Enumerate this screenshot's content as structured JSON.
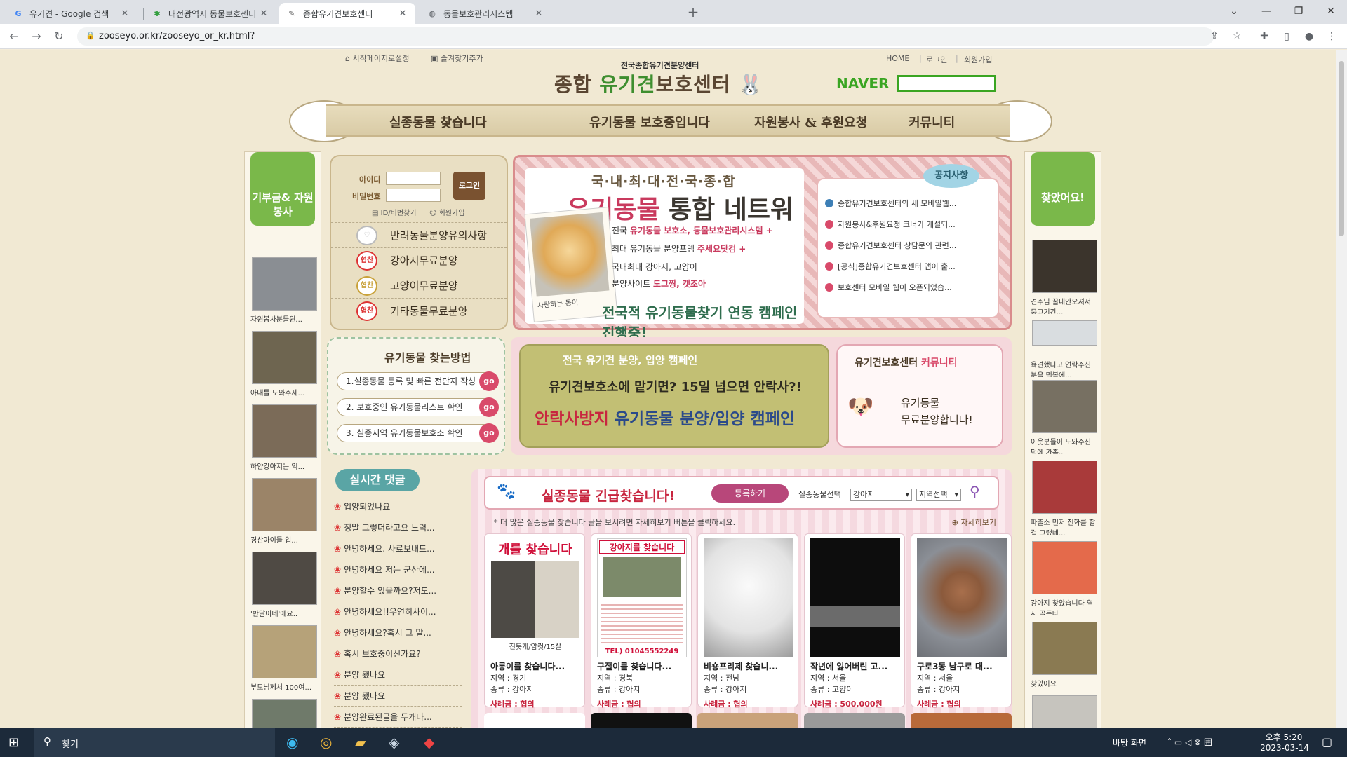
{
  "browser": {
    "tabs": [
      {
        "title": "유기견 - Google 검색",
        "icon": "google-icon"
      },
      {
        "title": "대전광역시 동물보호센터",
        "icon": "leaf-icon"
      },
      {
        "title": "종합유기견보호센터",
        "icon": "site-icon"
      },
      {
        "title": "동물보호관리시스템",
        "icon": "globe-icon"
      }
    ],
    "url": "zooseyo.or.kr/zooseyo_or_kr.html?"
  },
  "header": {
    "start_page": "시작페이지로설정",
    "bookmark": "즐겨찾기추가",
    "home": "HOME",
    "login": "로그인",
    "join": "회원가입",
    "logo_sub": "전국종합유기견분양센터",
    "logo_main_1": "종합",
    "logo_main_2": "유기견",
    "logo_main_3": "보호센터",
    "naver": "NAVER"
  },
  "menu": [
    "실종동물 찾습니다",
    "유기동물 보호중입니다",
    "자원봉사 & 후원요청",
    "커뮤니티"
  ],
  "left_side": {
    "title": "기부금& 자원봉사",
    "items": [
      "자원봉사분들원...",
      "아내를 도와주세...",
      "하얀강아지는 익...",
      "경산아이들 입...",
      "'반달이네'에요..",
      "부모님께서 100여..."
    ]
  },
  "right_side": {
    "title": "찾았어요!",
    "items": [
      "견주님 꿀내안오셔서 뭉고기간...",
      "",
      "육견했다고 연락주신 분을 먹볼에...",
      "이웃분들이 도와주신 덕에 가족..",
      "파출소 먼저 전화를 할걸 그랬네...",
      "강아지 찾았습니다 역시 골든타...",
      "찾았어요"
    ]
  },
  "login": {
    "id_label": "아이디",
    "pw_label": "비밀번호",
    "button": "로그인",
    "find": "ID/비번찾기",
    "join": "회원가입",
    "menu": [
      {
        "icon": "heart-icon",
        "label": "반려동물분양유의사항",
        "badge": ""
      },
      {
        "icon": "badge-icon",
        "label": "강아지무료분양",
        "badge": "협찬"
      },
      {
        "icon": "badge-icon",
        "label": "고양이무료분양",
        "badge": "협찬"
      },
      {
        "icon": "badge-icon",
        "label": "기타동물무료분양",
        "badge": "협찬"
      }
    ]
  },
  "banner": {
    "line1": "국·내·최·대·전·국·종·합",
    "line2a": "유기동물",
    "line2b": "통합 네트워크!",
    "dog_caption": "사랑하는 몽이",
    "lines": [
      {
        "pre": "전국 ",
        "hl": "유기동물 보호소, 동물보호관리시스템 +",
        "post": ""
      },
      {
        "pre": "최대 유기동물 분양프렘 ",
        "hl": "주세요닷컴 +",
        "post": ""
      },
      {
        "pre": "국내최대 강아지, 고양이",
        "hl": "",
        "post": ""
      },
      {
        "pre": "분양사이트 ",
        "hl": "도그짱, 캣조아",
        "post": ""
      }
    ],
    "line_last": "전국적 유기동물찾기 연동 캠페인 진행중!"
  },
  "notice": {
    "title": "공지사항",
    "items": [
      "종합유기견보호센터의 새 모바일웹...",
      "자원봉사&후원요청 코너가 개설되...",
      "종합유기견보호센터 상담문의 관련...",
      "[공식]종합유기견보호센터 앱이 출...",
      "보호센터 모바일 웹이 오픈되었습..."
    ]
  },
  "howto": {
    "title": "유기동물 찾는방법",
    "steps": [
      "1.실종동물 등록 및 빠른 전단지 작성",
      "2.  보호중인 유기동물리스트 확인",
      "3.  실종지역 유기동물보호소 확인"
    ],
    "go": "go"
  },
  "campaign": {
    "line1": "전국 유기견 분양, 입양 캠페인",
    "line2": "유기견보호소에 맡기면? 15일 넘으면 안락사?!",
    "line3a": "안락사방지",
    "line3b": "유기동물 분양/입양 캠페인",
    "comm_title_a": "유기견보호센터",
    "comm_title_b": "커뮤니티",
    "comm_body_1": "유기동물",
    "comm_body_2": "무료분양합니다!"
  },
  "comments": {
    "title": "실시간 댓글",
    "items": [
      "입양되었나요",
      "정말 그렇더라고요 노력...",
      "안녕하세요. 사료보내드...",
      "안녕하세요 저는 군산에...",
      "분양할수 있을까요?저도...",
      "안녕하세요!!우연히사이...",
      "안녕하세요?혹시 그 말...",
      "혹시 보호중이신가요?",
      "분양 됐나요",
      "분양 됐나요",
      "분양완료된글을 두개나..."
    ]
  },
  "missing": {
    "title": "실종동물 긴급찾습니다!",
    "register": "등록하기",
    "select_label": "실종동물선택",
    "select_animal": "강아지",
    "select_region": "지역선택",
    "hint": "* 더 많은 실종동물 찾습니다 글을 보시려면 자세히보기 버튼을 클릭하세요.",
    "more": "자세히보기",
    "region_label": "지역 : ",
    "type_label": "종류 : ",
    "reward_label": "사례금 : ",
    "cards": [
      {
        "title": "아롱이를 찾습니다...",
        "region": "경기",
        "type": "강아지",
        "reward": "협의",
        "poster": "개를 찾습니다",
        "poster_sub": "진돗개/암컷/15살"
      },
      {
        "title": "구절이를 찾습니다...",
        "region": "경북",
        "type": "강아지",
        "reward": "협의",
        "poster": "강아지를 찾습니다",
        "poster_sub": "TEL) 01045552249"
      },
      {
        "title": "비숑프리제 찾습니...",
        "region": "전남",
        "type": "강아지",
        "reward": "협의",
        "poster": "",
        "poster_sub": ""
      },
      {
        "title": "작년에 잃어버린 고...",
        "region": "서울",
        "type": "고양이",
        "reward": "500,000원",
        "poster": "",
        "poster_sub": ""
      },
      {
        "title": "구로3동 남구로 대...",
        "region": "서울",
        "type": "강아지",
        "reward": "협의",
        "poster": "",
        "poster_sub": ""
      }
    ]
  },
  "taskbar": {
    "search": "찾기",
    "desktop": "바탕 화면",
    "time": "오후 5:20",
    "date": "2023-03-14"
  }
}
